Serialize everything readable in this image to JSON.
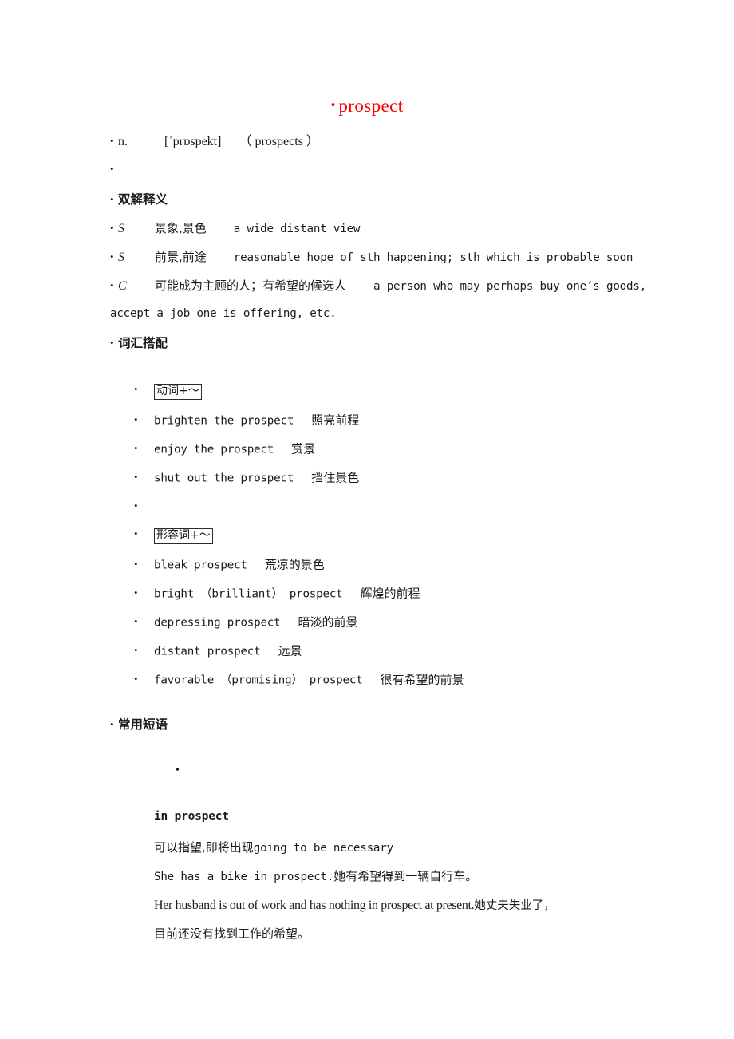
{
  "document": {
    "title_bullet": "•",
    "title": "prospect",
    "title_color": "#ff0000"
  },
  "headword": {
    "bullet": "•",
    "pos": "n.",
    "ipa": "[ˈprɒspekt]",
    "plural": "（ prospects ）"
  },
  "blank_bullet_1": "•",
  "sections": {
    "definitions": {
      "bullet": "•",
      "heading": "双解释义",
      "entries": [
        {
          "bullet": "•",
          "mark": "S",
          "chinese": "景象,景色",
          "english": "a wide distant view"
        },
        {
          "bullet": "•",
          "mark": "S",
          "chinese": "前景,前途",
          "english": "reasonable hope of sth happening; sth which is probable soon"
        },
        {
          "bullet": "•",
          "mark": "C",
          "chinese": "可能成为主顾的人；有希望的候选人",
          "english": "a person who may perhaps buy one’s goods,",
          "english_cont": "accept a job one is offering, etc."
        }
      ]
    },
    "collocations": {
      "bullet": "•",
      "heading": "词汇搭配",
      "groups": [
        {
          "label_bullet": "•",
          "label": "动词+～",
          "items": [
            {
              "bullet": "•",
              "english": "brighten the prospect",
              "chinese": "照亮前程"
            },
            {
              "bullet": "•",
              "english": "enjoy the prospect",
              "chinese": "赏景"
            },
            {
              "bullet": "•",
              "english": "shut out the prospect",
              "chinese": "挡住景色"
            }
          ],
          "blank_bullet": "•"
        },
        {
          "label_bullet": "•",
          "label": "形容词+～",
          "items": [
            {
              "bullet": "•",
              "english": "bleak prospect",
              "chinese": "荒凉的景色"
            },
            {
              "bullet": "•",
              "english": "bright （brilliant） prospect",
              "chinese": "辉煌的前程"
            },
            {
              "bullet": "•",
              "english": "depressing prospect",
              "chinese": "暗淡的前景"
            },
            {
              "bullet": "•",
              "english": "distant prospect",
              "chinese": "远景"
            },
            {
              "bullet": "•",
              "english": "favorable （promising） prospect",
              "chinese": "很有希望的前景"
            }
          ]
        }
      ]
    },
    "phrases": {
      "bullet": "•",
      "heading": "常用短语",
      "lone_bullet": "•",
      "entry": {
        "phrase": "in prospect",
        "gloss_cn": "可以指望,即将出现",
        "gloss_en": "going to be necessary",
        "examples": [
          {
            "en": "She has a bike in prospect.",
            "cn": "她有希望得到一辆自行车。"
          },
          {
            "en": "Her husband is out of work and has nothing in prospect at present.",
            "cn": "她丈夫失业了，",
            "cn_cont": "目前还没有找到工作的希望。"
          }
        ]
      }
    }
  }
}
